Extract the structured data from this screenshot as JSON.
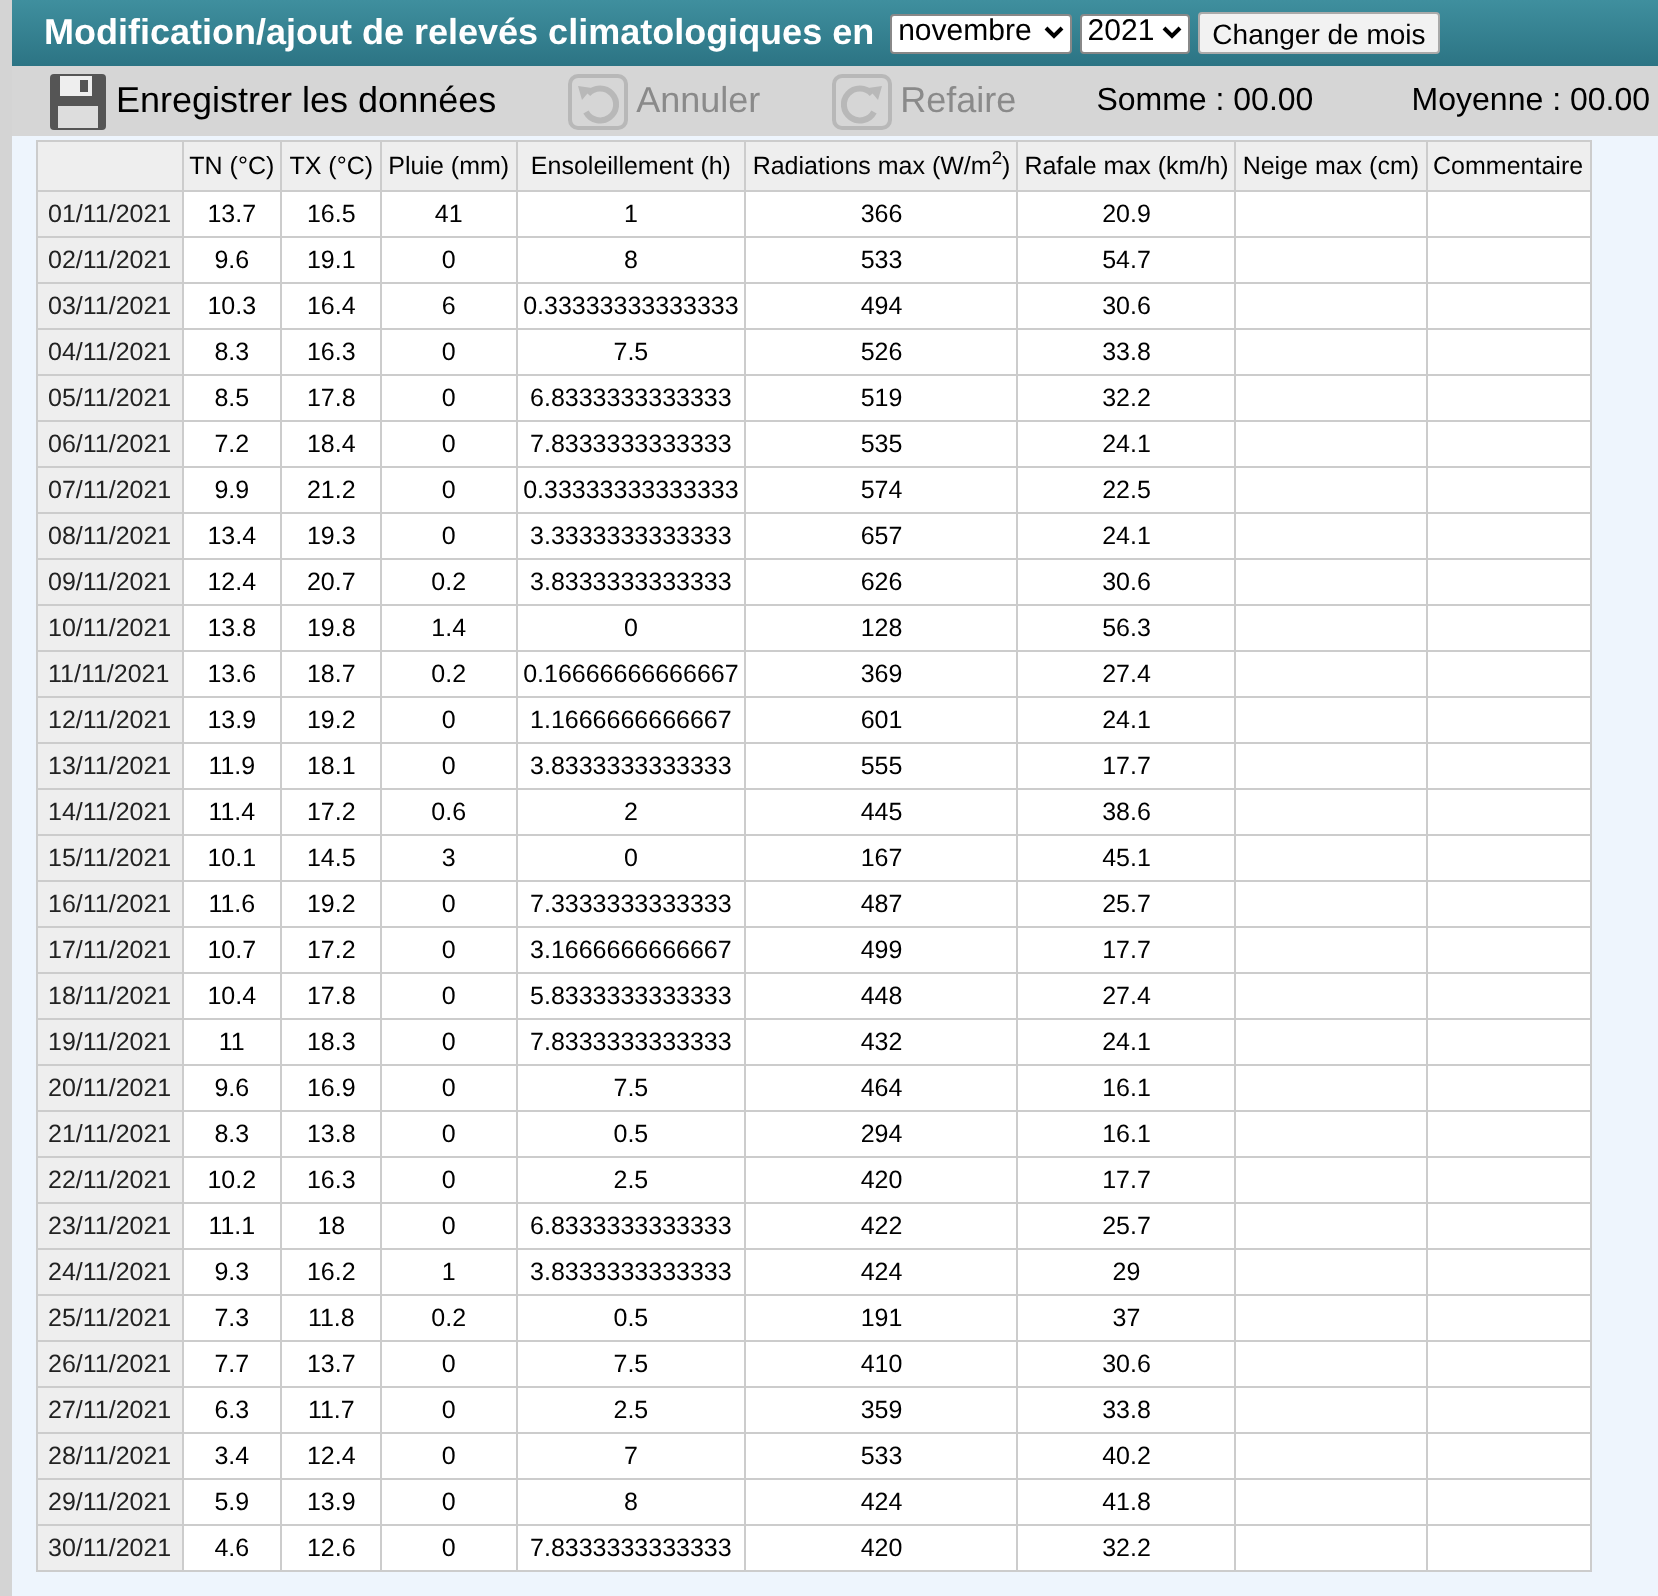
{
  "header": {
    "title": "Modification/ajout de relevés climatologiques en",
    "month": "novembre",
    "year": "2021",
    "button": "Changer de mois"
  },
  "toolbar": {
    "items": [
      {
        "kind": "save",
        "label": "Enregistrer les données",
        "disabled": false
      },
      {
        "kind": "undo",
        "label": "Annuler",
        "disabled": true
      },
      {
        "kind": "redo",
        "label": "Refaire",
        "disabled": true
      }
    ],
    "sum": "Somme : 00.00",
    "average": "Moyenne : 00.00"
  },
  "table": {
    "columns": [
      "TN (°C)",
      "TX (°C)",
      "Pluie (mm)",
      "Ensoleillement (h)",
      "Radiations max (W/m$^{2}$)",
      "Rafale max (km/h)",
      "Neige max (cm)",
      "Commentaire"
    ],
    "rows": [
      {
        "date": "01/11/2021",
        "cells": [
          "13.7",
          "16.5",
          "41",
          "1",
          "366",
          "20.9"
        ]
      },
      {
        "date": "02/11/2021",
        "cells": [
          "9.6",
          "19.1",
          "0",
          "8",
          "533",
          "54.7"
        ]
      },
      {
        "date": "03/11/2021",
        "cells": [
          "10.3",
          "16.4",
          "6",
          "0.33333333333333",
          "494",
          "30.6"
        ]
      },
      {
        "date": "04/11/2021",
        "cells": [
          "8.3",
          "16.3",
          "0",
          "7.5",
          "526",
          "33.8"
        ]
      },
      {
        "date": "05/11/2021",
        "cells": [
          "8.5",
          "17.8",
          "0",
          "6.8333333333333",
          "519",
          "32.2"
        ]
      },
      {
        "date": "06/11/2021",
        "cells": [
          "7.2",
          "18.4",
          "0",
          "7.8333333333333",
          "535",
          "24.1"
        ]
      },
      {
        "date": "07/11/2021",
        "cells": [
          "9.9",
          "21.2",
          "0",
          "0.33333333333333",
          "574",
          "22.5"
        ]
      },
      {
        "date": "08/11/2021",
        "cells": [
          "13.4",
          "19.3",
          "0",
          "3.3333333333333",
          "657",
          "24.1"
        ]
      },
      {
        "date": "09/11/2021",
        "cells": [
          "12.4",
          "20.7",
          "0.2",
          "3.8333333333333",
          "626",
          "30.6"
        ]
      },
      {
        "date": "10/11/2021",
        "cells": [
          "13.8",
          "19.8",
          "1.4",
          "0",
          "128",
          "56.3"
        ]
      },
      {
        "date": "11/11/2021",
        "cells": [
          "13.6",
          "18.7",
          "0.2",
          "0.16666666666667",
          "369",
          "27.4"
        ]
      },
      {
        "date": "12/11/2021",
        "cells": [
          "13.9",
          "19.2",
          "0",
          "1.1666666666667",
          "601",
          "24.1"
        ]
      },
      {
        "date": "13/11/2021",
        "cells": [
          "11.9",
          "18.1",
          "0",
          "3.8333333333333",
          "555",
          "17.7"
        ]
      },
      {
        "date": "14/11/2021",
        "cells": [
          "11.4",
          "17.2",
          "0.6",
          "2",
          "445",
          "38.6"
        ]
      },
      {
        "date": "15/11/2021",
        "cells": [
          "10.1",
          "14.5",
          "3",
          "0",
          "167",
          "45.1"
        ]
      },
      {
        "date": "16/11/2021",
        "cells": [
          "11.6",
          "19.2",
          "0",
          "7.3333333333333",
          "487",
          "25.7"
        ]
      },
      {
        "date": "17/11/2021",
        "cells": [
          "10.7",
          "17.2",
          "0",
          "3.1666666666667",
          "499",
          "17.7"
        ]
      },
      {
        "date": "18/11/2021",
        "cells": [
          "10.4",
          "17.8",
          "0",
          "5.8333333333333",
          "448",
          "27.4"
        ]
      },
      {
        "date": "19/11/2021",
        "cells": [
          "11",
          "18.3",
          "0",
          "7.8333333333333",
          "432",
          "24.1"
        ]
      },
      {
        "date": "20/11/2021",
        "cells": [
          "9.6",
          "16.9",
          "0",
          "7.5",
          "464",
          "16.1"
        ]
      },
      {
        "date": "21/11/2021",
        "cells": [
          "8.3",
          "13.8",
          "0",
          "0.5",
          "294",
          "16.1"
        ]
      },
      {
        "date": "22/11/2021",
        "cells": [
          "10.2",
          "16.3",
          "0",
          "2.5",
          "420",
          "17.7"
        ]
      },
      {
        "date": "23/11/2021",
        "cells": [
          "11.1",
          "18",
          "0",
          "6.8333333333333",
          "422",
          "25.7"
        ]
      },
      {
        "date": "24/11/2021",
        "cells": [
          "9.3",
          "16.2",
          "1",
          "3.8333333333333",
          "424",
          "29"
        ]
      },
      {
        "date": "25/11/2021",
        "cells": [
          "7.3",
          "11.8",
          "0.2",
          "0.5",
          "191",
          "37"
        ]
      },
      {
        "date": "26/11/2021",
        "cells": [
          "7.7",
          "13.7",
          "0",
          "7.5",
          "410",
          "30.6"
        ]
      },
      {
        "date": "27/11/2021",
        "cells": [
          "6.3",
          "11.7",
          "0",
          "2.5",
          "359",
          "33.8"
        ]
      },
      {
        "date": "28/11/2021",
        "cells": [
          "3.4",
          "12.4",
          "0",
          "7",
          "533",
          "40.2"
        ]
      },
      {
        "date": "29/11/2021",
        "cells": [
          "5.9",
          "13.9",
          "0",
          "8",
          "424",
          "41.8"
        ]
      },
      {
        "date": "30/11/2021",
        "cells": [
          "4.6",
          "12.6",
          "0",
          "7.8333333333333",
          "420",
          "32.2"
        ]
      }
    ]
  }
}
